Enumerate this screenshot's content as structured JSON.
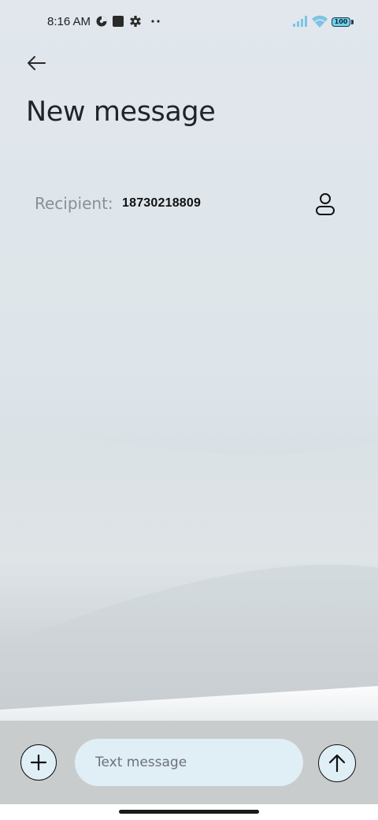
{
  "status_bar": {
    "time": "8:16 AM",
    "battery_level": "100",
    "icons": [
      "data-saver-icon",
      "square-notification-icon",
      "settings-gear-icon",
      "more-dots-icon",
      "cellular-signal-icon",
      "wifi-icon",
      "battery-icon"
    ]
  },
  "header": {
    "back_icon": "back-arrow-icon",
    "title": "New message"
  },
  "recipient": {
    "label": "Recipient:",
    "value": "18730218809",
    "contact_icon": "person-icon"
  },
  "compose": {
    "attach_icon": "plus-icon",
    "placeholder": "Text message",
    "value": "",
    "send_icon": "arrow-up-icon"
  },
  "colors": {
    "background_top": "#e1e7ec",
    "background_bottom": "#c7ccd0",
    "input_fill": "#e0eef6",
    "compose_bar": "#c9cccd"
  }
}
